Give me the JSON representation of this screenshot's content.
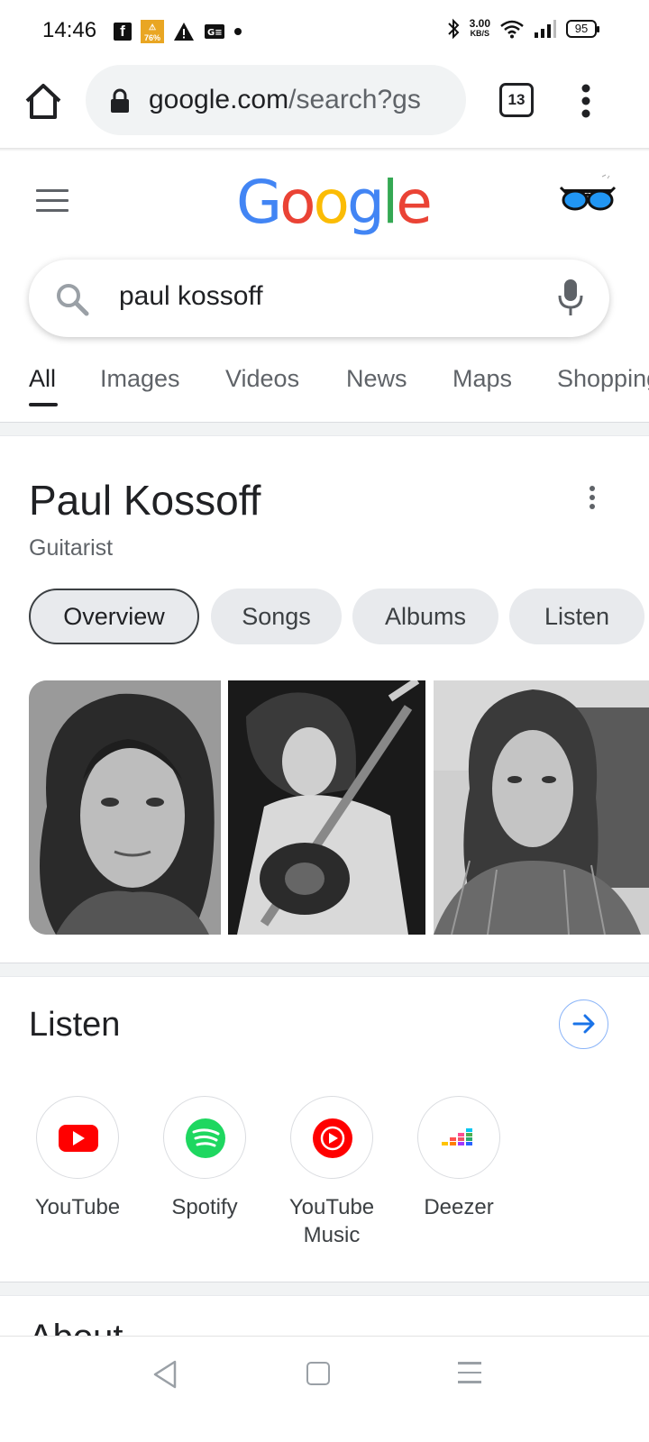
{
  "status_bar": {
    "time": "14:46",
    "speed_value": "3.00",
    "speed_unit": "KB/S",
    "battery": "95",
    "notif_badge": "76%",
    "icons": [
      "facebook-icon",
      "app-notification-icon",
      "warning-icon",
      "news-icon",
      "dot-icon",
      "bluetooth-icon",
      "wifi-icon",
      "signal-icon",
      "battery-icon"
    ]
  },
  "browser": {
    "url_host": "google.com",
    "url_rest": "/search?gs",
    "tab_count": "13"
  },
  "google": {
    "logo_letters": [
      {
        "char": "G",
        "color": "#4285F4"
      },
      {
        "char": "o",
        "color": "#EA4335"
      },
      {
        "char": "o",
        "color": "#FBBC05"
      },
      {
        "char": "g",
        "color": "#4285F4"
      },
      {
        "char": "l",
        "color": "#34A853"
      },
      {
        "char": "e",
        "color": "#EA4335"
      }
    ],
    "query": "paul kossoff"
  },
  "search_tabs": [
    "All",
    "Images",
    "Videos",
    "News",
    "Maps",
    "Shopping"
  ],
  "knowledge_panel": {
    "title": "Paul Kossoff",
    "subtitle": "Guitarist",
    "chips": [
      "Overview",
      "Songs",
      "Albums",
      "Listen"
    ]
  },
  "listen": {
    "title": "Listen",
    "providers": [
      {
        "name": "YouTube",
        "color": "#FF0000"
      },
      {
        "name": "Spotify",
        "color": "#1ED760"
      },
      {
        "name": "YouTube Music",
        "color": "#FF0000"
      },
      {
        "name": "Deezer",
        "color": "#A238FF"
      }
    ]
  },
  "about_peek": "About"
}
